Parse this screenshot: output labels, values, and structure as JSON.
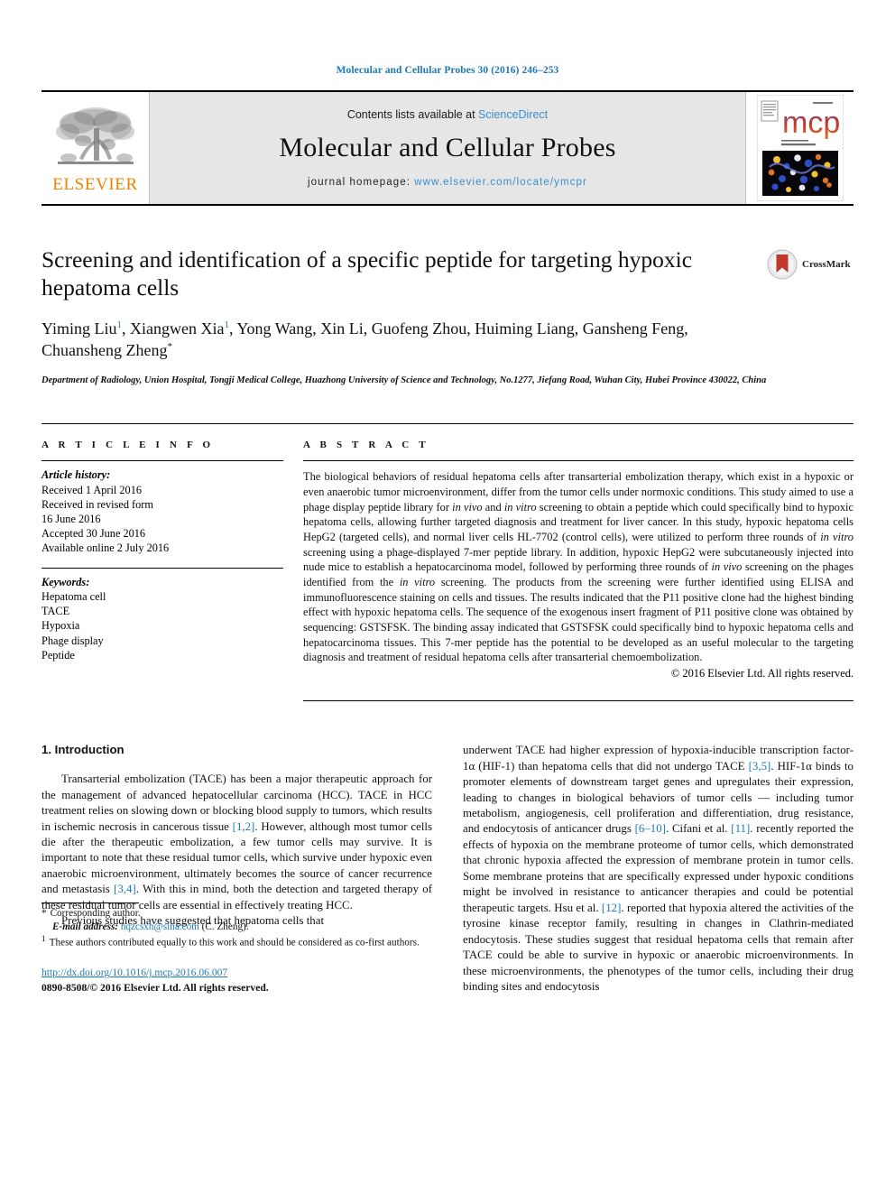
{
  "running_head": "Molecular and Cellular Probes 30 (2016) 246–253",
  "masthead": {
    "publisher_logo_label": "ELSEVIER",
    "contents_prefix": "Contents lists available at ",
    "contents_link": "ScienceDirect",
    "journal_name": "Molecular and Cellular Probes",
    "homepage_prefix": "journal homepage: ",
    "homepage_url": "www.elsevier.com/locate/ymcpr",
    "cover_logo_text": "mcp",
    "cover_caption": "Molecular and Cellular Probes"
  },
  "article": {
    "title": "Screening and identification of a specific peptide for targeting hypoxic hepatoma cells",
    "crossmark_label": "CrossMark",
    "authors": [
      {
        "name": "Yiming Liu",
        "sup": "1",
        "sep": ", "
      },
      {
        "name": "Xiangwen Xia",
        "sup": "1",
        "sep": ", "
      },
      {
        "name": "Yong Wang",
        "sup": "",
        "sep": ", "
      },
      {
        "name": "Xin Li",
        "sup": "",
        "sep": ", "
      },
      {
        "name": "Guofeng Zhou",
        "sup": "",
        "sep": ", "
      },
      {
        "name": "Huiming Liang",
        "sup": "",
        "sep": ", "
      },
      {
        "name": "Gansheng Feng",
        "sup": "",
        "sep": ", "
      },
      {
        "name": "Chuansheng Zheng",
        "sup": "*",
        "sep": ""
      }
    ],
    "affiliation": "Department of Radiology, Union Hospital, Tongji Medical College, Huazhong University of Science and Technology, No.1277, Jiefang Road, Wuhan City, Hubei Province 430022, China"
  },
  "article_info": {
    "heading": "A R T I C L E  I N F O",
    "history_label": "Article history:",
    "history": [
      "Received 1 April 2016",
      "Received in revised form",
      "16 June 2016",
      "Accepted 30 June 2016",
      "Available online 2 July 2016"
    ],
    "keywords_label": "Keywords:",
    "keywords": [
      "Hepatoma cell",
      "TACE",
      "Hypoxia",
      "Phage display",
      "Peptide"
    ]
  },
  "abstract": {
    "heading": "A B S T R A C T",
    "text": "The biological behaviors of residual hepatoma cells after transarterial embolization therapy, which exist in a hypoxic or even anaerobic tumor microenvironment, differ from the tumor cells under normoxic conditions. This study aimed to use a phage display peptide library for in vivo and in vitro screening to obtain a peptide which could specifically bind to hypoxic hepatoma cells, allowing further targeted diagnosis and treatment for liver cancer. In this study, hypoxic hepatoma cells HepG2 (targeted cells), and normal liver cells HL-7702 (control cells), were utilized to perform three rounds of in vitro screening using a phage-displayed 7-mer peptide library. In addition, hypoxic HepG2 were subcutaneously injected into nude mice to establish a hepatocarcinoma model, followed by performing three rounds of in vivo screening on the phages identified from the in vitro screening. The products from the screening were further identified using ELISA and immunofluorescence staining on cells and tissues. The results indicated that the P11 positive clone had the highest binding effect with hypoxic hepatoma cells. The sequence of the exogenous insert fragment of P11 positive clone was obtained by sequencing: GSTSFSK. The binding assay indicated that GSTSFSK could specifically bind to hypoxic hepatoma cells and hepatocarcinoma tissues. This 7-mer peptide has the potential to be developed as an useful molecular to the targeting diagnosis and treatment of residual hepatoma cells after transarterial chemoembolization.",
    "copyright": "© 2016 Elsevier Ltd. All rights reserved."
  },
  "introduction": {
    "section_number": "1.",
    "section_title": "Introduction",
    "left_paragraphs": [
      "Transarterial embolization (TACE) has been a major therapeutic approach for the management of advanced hepatocellular carcinoma (HCC). TACE in HCC treatment relies on slowing down or blocking blood supply to tumors, which results in ischemic necrosis in cancerous tissue [1,2]. However, although most tumor cells die after the therapeutic embolization, a few tumor cells may survive. It is important to note that these residual tumor cells, which survive under hypoxic even anaerobic microenvironment, ultimately becomes the source of cancer recurrence and metastasis [3,4]. With this in mind, both the detection and targeted therapy of these residual tumor cells are essential in effectively treating HCC.",
      "Previous studies have suggested that hepatoma cells that"
    ],
    "right_paragraphs": [
      "underwent TACE had higher expression of hypoxia-inducible transcription factor-1α (HIF-1) than hepatoma cells that did not undergo TACE [3,5]. HIF-1α binds to promoter elements of downstream target genes and upregulates their expression, leading to changes in biological behaviors of tumor cells — including tumor metabolism, angiogenesis, cell proliferation and differentiation, drug resistance, and endocytosis of anticancer drugs [6–10]. Cifani et al. [11]. recently reported the effects of hypoxia on the membrane proteome of tumor cells, which demonstrated that chronic hypoxia affected the expression of membrane protein in tumor cells. Some membrane proteins that are specifically expressed under hypoxic conditions might be involved in resistance to anticancer therapies and could be potential therapeutic targets. Hsu et al. [12]. reported that hypoxia altered the activities of the tyrosine kinase receptor family, resulting in changes in Clathrin-mediated endocytosis. These studies suggest that residual hepatoma cells that remain after TACE could be able to survive in hypoxic or anaerobic microenvironments. In these microenvironments, the phenotypes of the tumor cells, including their drug binding sites and endocytosis"
    ],
    "inline_refs_left": [
      "[1,2]",
      "[3,4]"
    ],
    "inline_refs_right": [
      "[3,5]",
      "[6–10]",
      "[11]",
      "[12]"
    ]
  },
  "footnotes": {
    "corresponding_marker": "*",
    "corresponding_text": "Corresponding author.",
    "email_label": "E-mail address:",
    "email": "hqzcsxh@sina.com",
    "email_suffix": "(C. Zheng).",
    "equal_marker": "1",
    "equal_text": "These authors contributed equally to this work and should be considered as co-first authors."
  },
  "footer": {
    "doi": "http://dx.doi.org/10.1016/j.mcp.2016.06.007",
    "issn_line": "0890-8508/© 2016 Elsevier Ltd. All rights reserved."
  },
  "colors": {
    "link_blue": "#1b7ab5",
    "elsevier_orange": "#ef8200",
    "masthead_gray": "#e6e6e6"
  }
}
